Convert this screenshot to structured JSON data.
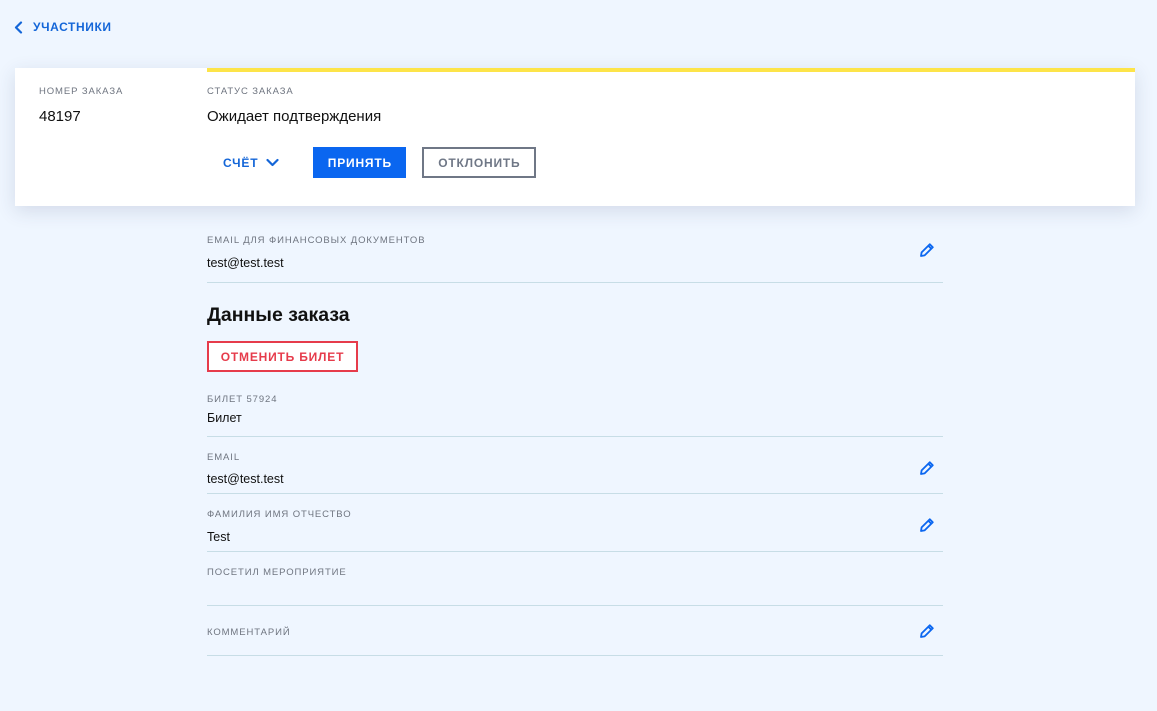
{
  "nav": {
    "back_label": "УЧАСТНИКИ"
  },
  "order_card": {
    "order_number_label": "НОМЕР ЗАКАЗА",
    "order_number": "48197",
    "status_label": "СТАТУС ЗАКАЗА",
    "status_value": "Ожидает подтверждения",
    "status_color": "#fde449",
    "invoice_label": "СЧЁТ",
    "accept_label": "ПРИНЯТЬ",
    "decline_label": "ОТКЛОНИТЬ"
  },
  "finance_email": {
    "label": "EMAIL ДЛЯ ФИНАНСОВЫХ ДОКУМЕНТОВ",
    "value": "test@test.test"
  },
  "order_data": {
    "title": "Данные заказа",
    "cancel_ticket_label": "ОТМЕНИТЬ БИЛЕТ",
    "ticket_label": "БИЛЕТ 57924",
    "ticket_value": "Билет",
    "fields": [
      {
        "label": "EMAIL",
        "value": "test@test.test",
        "editable": true
      },
      {
        "label": "ФАМИЛИЯ ИМЯ ОТЧЕСТВО",
        "value": "Test",
        "editable": true
      },
      {
        "label": "ПОСЕТИЛ МЕРОПРИЯТИЕ",
        "value": "",
        "editable": false
      },
      {
        "label": "КОММЕНТАРИЙ",
        "value": "",
        "editable": true
      }
    ]
  },
  "colors": {
    "accent": "#0a66f0",
    "link": "#1466d8",
    "danger": "#e63b4b",
    "background": "#eff6ff"
  }
}
